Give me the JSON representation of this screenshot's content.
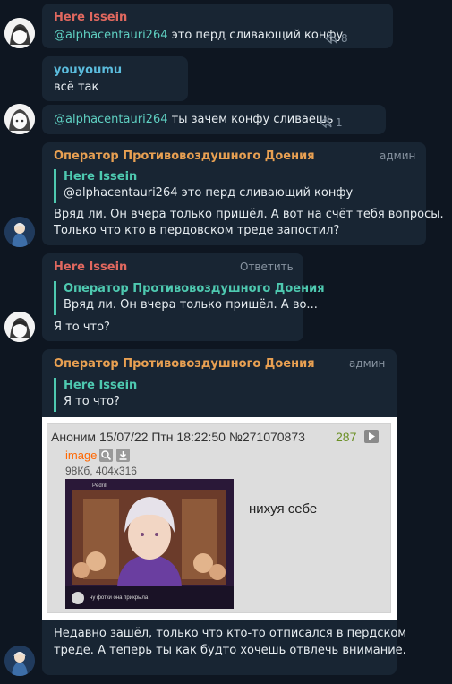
{
  "colors": {
    "background": "#0e1621",
    "bubble": "#182533",
    "name_red": "#e0685f",
    "name_blue": "#5bbcdd",
    "name_orange": "#e8a052",
    "quote_accent": "#4ec9b0",
    "mention": "#5fd0c2"
  },
  "messages": [
    {
      "author": "Here Issein",
      "mention": "@alphacentauri264",
      "text": " это перд сливающий конфу",
      "forwards": "8"
    },
    {
      "author": "youyoumu",
      "text": "всё так"
    },
    {
      "mention": "@alphacentauri264",
      "text": " ты зачем конфу сливаешь",
      "forwards": "1"
    },
    {
      "author": "Оператор Противовоздушного Доения",
      "role": "админ",
      "reply": {
        "author": "Here Issein",
        "text": "@alphacentauri264 это перд сливающий конфу"
      },
      "lines": [
        "Вряд ли. Он вчера только пришёл. А вот на счёт тебя вопросы.",
        "Только что кто в пердовском треде запостил?"
      ]
    },
    {
      "author": "Here Issein",
      "action": "Ответить",
      "reply": {
        "author": "Оператор Противовоздушного Доения",
        "text": "Вряд ли. Он вчера только пришёл. А во..."
      },
      "text": "Я то что?"
    },
    {
      "author": "Оператор Противовоздушного Доения",
      "role": "админ",
      "reply": {
        "author": "Here Issein",
        "text": "Я то что?"
      },
      "post": {
        "poster": "Аноним",
        "date": "15/07/22 Птн 18:22:50",
        "number": "№271070873",
        "count": "287",
        "file_label": "image",
        "file_info": "98Кб, 404x316",
        "body": "нихуя себе",
        "thumb_top_text": "Pedrill",
        "thumb_caption": "ну фотки она прикрыла"
      },
      "lines": [
        "Недавно зашёл, только что кто-то отписался в пердском",
        "треде. А теперь ты как будто хочешь отвлечь внимание."
      ]
    }
  ]
}
